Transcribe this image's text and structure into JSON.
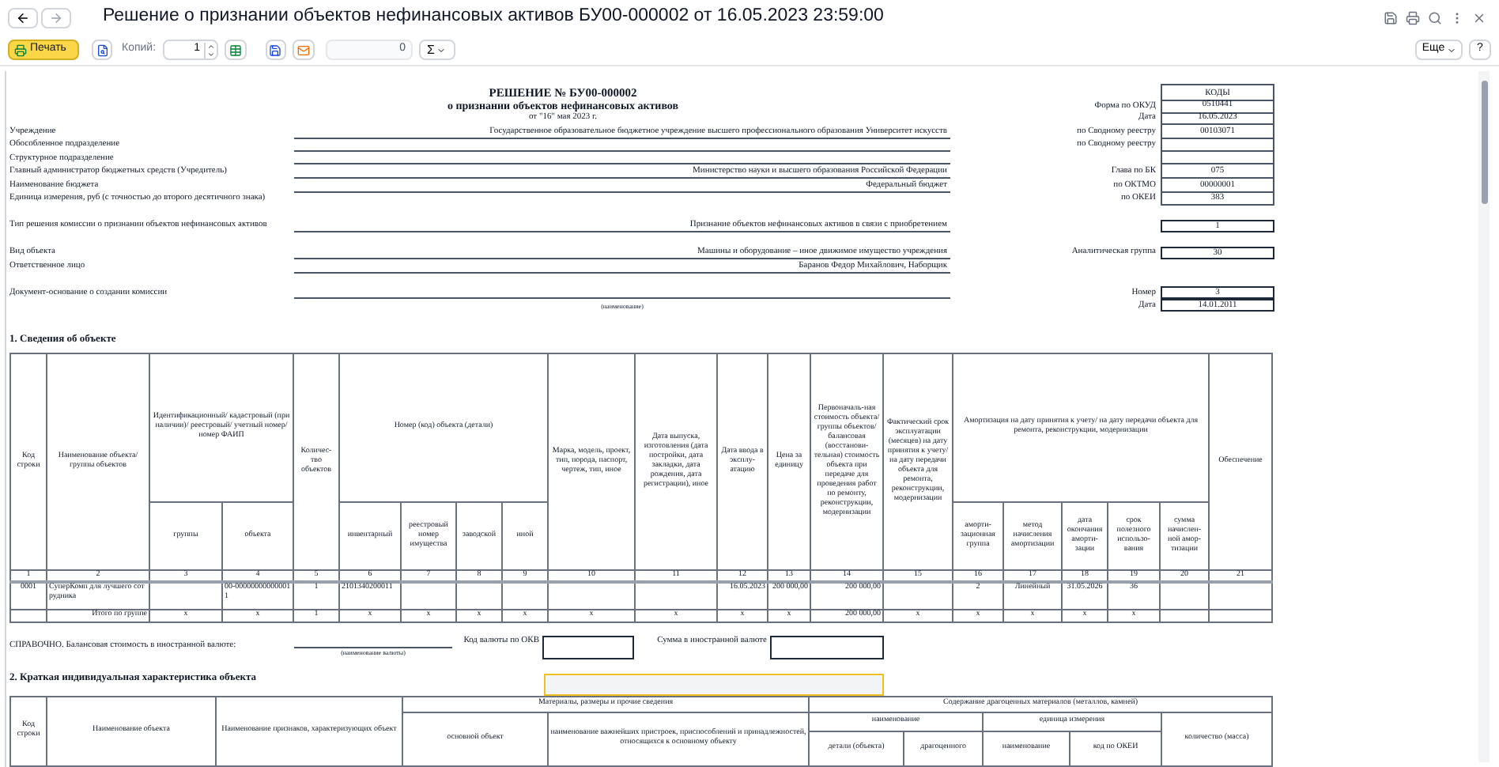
{
  "window": {
    "title": "Решение о признании объектов нефинансовых активов БУ00-000002 от 16.05.2023 23:59:00"
  },
  "toolbar": {
    "print_button": "Печать",
    "copies_label": "Копий:",
    "copies_value": "1",
    "sum_value": "0",
    "sum_button": "Σ",
    "more_button": "Еще",
    "help_button": "?"
  },
  "document": {
    "rows": [
      {
        "kind": "title",
        "text": "РЕШЕНИЕ № БУ00-000002",
        "code": {
          "kind": "header",
          "value": "КОДЫ"
        }
      },
      {
        "kind": "subtitle",
        "text": "о признании объектов нефинансовых активов",
        "code": {
          "kind": "cell",
          "label": "Форма по ОКУД",
          "value": "0510441"
        }
      },
      {
        "kind": "date",
        "text": "от \"16\" мая 2023 г.",
        "code": {
          "kind": "cell",
          "label": "Дата",
          "value": "16.05.2023"
        }
      },
      {
        "kind": "field",
        "label": "Учреждение",
        "value": "Государственное образовательное бюджетное учреждение высшего профессионального образования Университет искусств",
        "line": true,
        "code": {
          "kind": "cell",
          "label": "по Сводному реестру",
          "value": "00103071"
        }
      },
      {
        "kind": "field",
        "label": "Обособленное подразделение",
        "line": true,
        "code": {
          "kind": "cell",
          "label": "по Сводному реестру"
        }
      },
      {
        "kind": "field",
        "label": "Структурное подразделение",
        "line": true,
        "code": {
          "kind": "cell"
        }
      },
      {
        "kind": "field",
        "label": "Главный администратор бюджетных средств (Учредитель)",
        "value": "Министерство науки и высшего образования Российской Федерации",
        "line": true,
        "code": {
          "kind": "cell",
          "label": "Глава по БК",
          "value": "075"
        }
      },
      {
        "kind": "field",
        "label": "Наименование бюджета",
        "value": "Федеральный бюджет",
        "line": true,
        "code": {
          "kind": "cell",
          "label": "по ОКТМО",
          "value": "00000001"
        }
      },
      {
        "kind": "field",
        "label": "Единица измерения, руб  (с точностью до второго десятичного знака)",
        "line": false,
        "code": {
          "kind": "cell",
          "label": "по ОКЕИ",
          "value": "383"
        }
      },
      {
        "kind": "gap"
      },
      {
        "kind": "field",
        "label": "Тип решения комиссии о признании объектов нефинансовых активов",
        "value": "Признание объектов нефинансовых активов в связи с приобретением",
        "line": true,
        "code": {
          "kind": "single",
          "value": "1"
        }
      },
      {
        "kind": "gap"
      },
      {
        "kind": "field",
        "label": "Вид объекта",
        "value": "Машины и оборудование – иное движимое имущество учреждения",
        "line": true,
        "code": {
          "kind": "single",
          "label": "Аналитическая группа",
          "value": "30"
        }
      },
      {
        "kind": "field",
        "label": "Ответственное лицо",
        "value": "Баранов Федор Михайлович, Наборщик",
        "line": true
      },
      {
        "kind": "gap"
      },
      {
        "kind": "field",
        "label": "Документ-основание о создании комиссии",
        "line": true,
        "code": {
          "kind": "single",
          "label": "Номер",
          "value": "3"
        }
      },
      {
        "kind": "caption",
        "text": "(наименование)",
        "code": {
          "kind": "single",
          "label": "Дата",
          "value": "14.01.2011"
        }
      }
    ],
    "section1": {
      "heading": "1. Сведения об объекте",
      "columns": [
        {
          "label": "Код строки"
        },
        {
          "label": "Наименование объекта/группы объектов"
        },
        {
          "label": "Идентификационный/ кадастровый (при наличии)/ реестровый/ учетный номер/ номер ФАИП",
          "colspan": 2,
          "children": [
            {
              "label": "группы"
            },
            {
              "label": "объекта"
            }
          ]
        },
        {
          "label": "Количес-тво объектов"
        },
        {
          "label": "Номер (код) объекта (детали)",
          "colspan": 4,
          "children": [
            {
              "label": "инвентарный"
            },
            {
              "label": "реестровый номер имущества"
            },
            {
              "label": "заводской"
            },
            {
              "label": "иной"
            }
          ]
        },
        {
          "label": "Марка, модель, проект, тип, порода, паспорт, чертеж, тип, иное"
        },
        {
          "label": "Дата выпуска, изготовления (дата постройки, дата закладки, дата рождения, дата регистрации), иное"
        },
        {
          "label": "Дата ввода в эксплу-атацию"
        },
        {
          "label": "Цена за единицу"
        },
        {
          "label": "Первоначаль-ная стоимость объекта/ группы объектов/ балансовая (восстанови-тельная) стоимость объекта при передаче для проведения работ по ремонту, реконструкции, модернизации"
        },
        {
          "label": "Фактический срок эксплуатации (месяцев) на дату принятия к учету/ на дату передачи объекта для ремонта, реконструкции, модернизации"
        },
        {
          "label": "Амортизация на дату принятия к учету/ на дату передачи объекта для ремонта, реконструкции, модернизации",
          "colspan": 5,
          "children": [
            {
              "label": "аморти-зационная группа"
            },
            {
              "label": "метод начисления амортизации"
            },
            {
              "label": "дата окончания аморти-зации"
            },
            {
              "label": "срок полезного использо-вания"
            },
            {
              "label": "сумма начислен-ной амор-тизации"
            }
          ]
        },
        {
          "label": "Обеспечение"
        }
      ],
      "numbers": [
        "1",
        "2",
        "3",
        "4",
        "5",
        "6",
        "7",
        "8",
        "9",
        "10",
        "11",
        "12",
        "13",
        "14",
        "15",
        "16",
        "17",
        "18",
        "19",
        "20",
        "21"
      ],
      "rows": [
        {
          "kind": "item",
          "cells": [
            "0001",
            "СуперКомп для лучшего сотрудника",
            "",
            "00-000000000000011",
            "1",
            "2101340200011",
            "",
            "",
            "",
            "",
            "",
            "16.05.2023",
            "200 000,00",
            "200 000,00",
            "",
            "2",
            "Линейный",
            "31.05.2026",
            "36",
            "",
            ""
          ]
        },
        {
          "kind": "total",
          "cells": [
            "",
            "Итого по группе",
            "x",
            "x",
            "1",
            "x",
            "x",
            "x",
            "x",
            "x",
            "x",
            "x",
            "x",
            "200 000,00",
            "x",
            "x",
            "x",
            "x",
            "x",
            "",
            ""
          ]
        }
      ]
    },
    "reference": {
      "label": "СПРАВОЧНО. Балансовая стоимость в иностранной валюте:",
      "currency_caption": "(наименование валюты)",
      "code_label": "Код валюты по ОКВ",
      "sum_label": "Сумма в иностранной валюте"
    },
    "section2": {
      "heading": "2. Краткая индивидуальная характеристика объекта",
      "columns": [
        {
          "label": "Код строки"
        },
        {
          "label": "Наименование объекта"
        },
        {
          "label": "Наименование признаков, характеризующих объект"
        },
        {
          "label": "Материалы, размеры и прочие сведения",
          "colspan": 2,
          "children": [
            {
              "label": "основной объект"
            },
            {
              "label": "наименование важнейших пристроек, приспособлений и принадлежностей,  относящихся к основному объекту"
            }
          ]
        },
        {
          "label": "Содержание драгоценных материалов (металлов, камней)",
          "colspan": 5,
          "children": [
            {
              "label": "наименование",
              "colspan": 2,
              "children": [
                {
                  "label": "детали (объекта)"
                },
                {
                  "label": "драгоценного"
                }
              ]
            },
            {
              "label": "единица измерения",
              "colspan": 2,
              "children": [
                {
                  "label": "наименование"
                },
                {
                  "label": "код по ОКЕИ"
                }
              ]
            },
            {
              "label": "количество (масса)"
            }
          ]
        }
      ]
    }
  }
}
